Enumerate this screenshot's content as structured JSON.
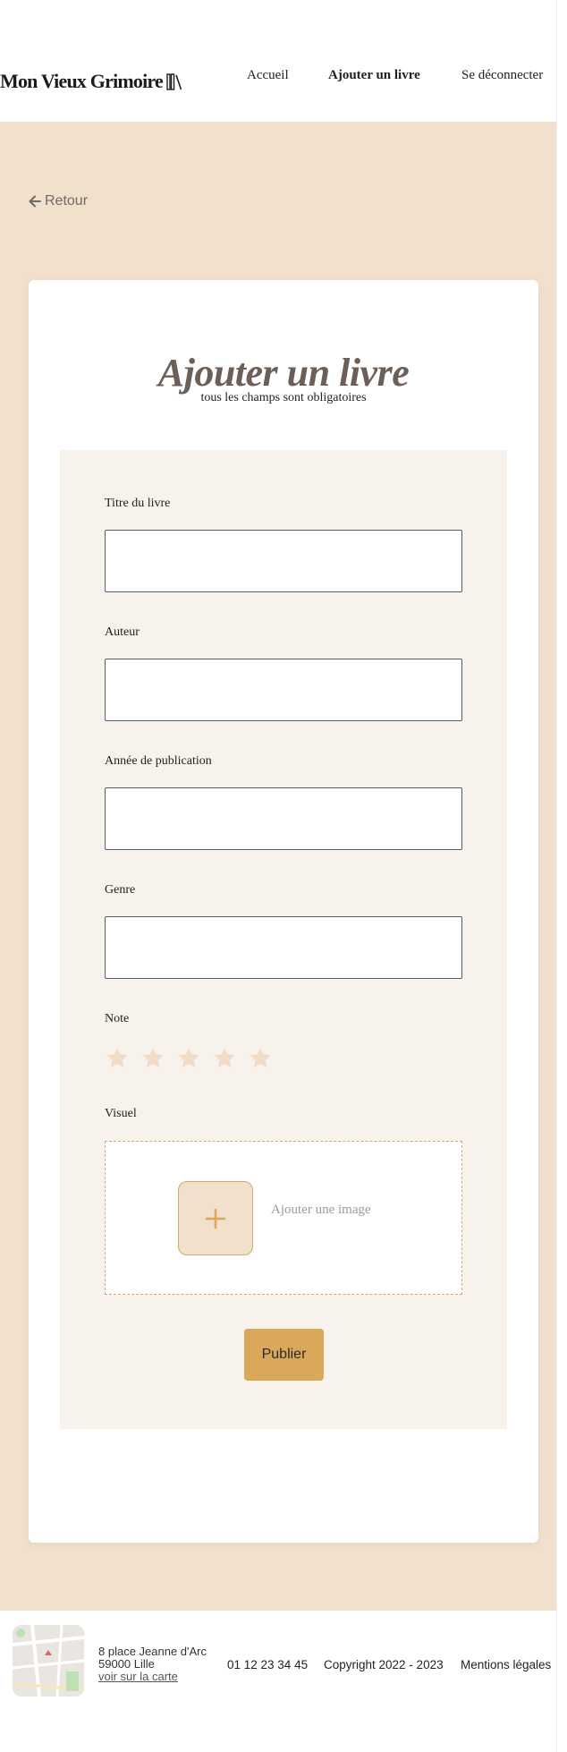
{
  "header": {
    "logo_text": "Mon Vieux Grimoire",
    "logo_icon": "books-icon",
    "nav": [
      {
        "label": "Accueil",
        "active": false
      },
      {
        "label": "Ajouter un livre",
        "active": true
      },
      {
        "label": "Se déconnecter",
        "active": false
      }
    ]
  },
  "main": {
    "back_label": "Retour",
    "back_icon": "arrow-left-icon",
    "form": {
      "title": "Ajouter un livre",
      "subtitle": "tous les champs sont obligatoires",
      "fields": [
        {
          "label": "Titre du livre",
          "value": "",
          "placeholder": ""
        },
        {
          "label": "Auteur",
          "value": "",
          "placeholder": ""
        },
        {
          "label": "Année de publication",
          "value": "",
          "placeholder": ""
        },
        {
          "label": "Genre",
          "value": "",
          "placeholder": ""
        }
      ],
      "rating": {
        "label": "Note",
        "max": 5,
        "value": 0
      },
      "image": {
        "label": "Visuel",
        "add_text": "Ajouter une image",
        "add_icon": "plus-icon"
      },
      "submit_label": "Publier"
    }
  },
  "footer": {
    "address_line1": "8 place Jeanne d'Arc",
    "address_line2": "59000 Lille",
    "map_link": "voir sur la carte",
    "phone": "01 12 23 34 45",
    "copyright": "Copyright 2022 - 2023",
    "legal": "Mentions légales"
  },
  "colors": {
    "background_beige": "#f0e0cc",
    "form_background": "#f7f2ec",
    "accent_gold": "#d9a85b",
    "star_empty": "#f2dcc6",
    "title_brown": "#6c5f57"
  }
}
